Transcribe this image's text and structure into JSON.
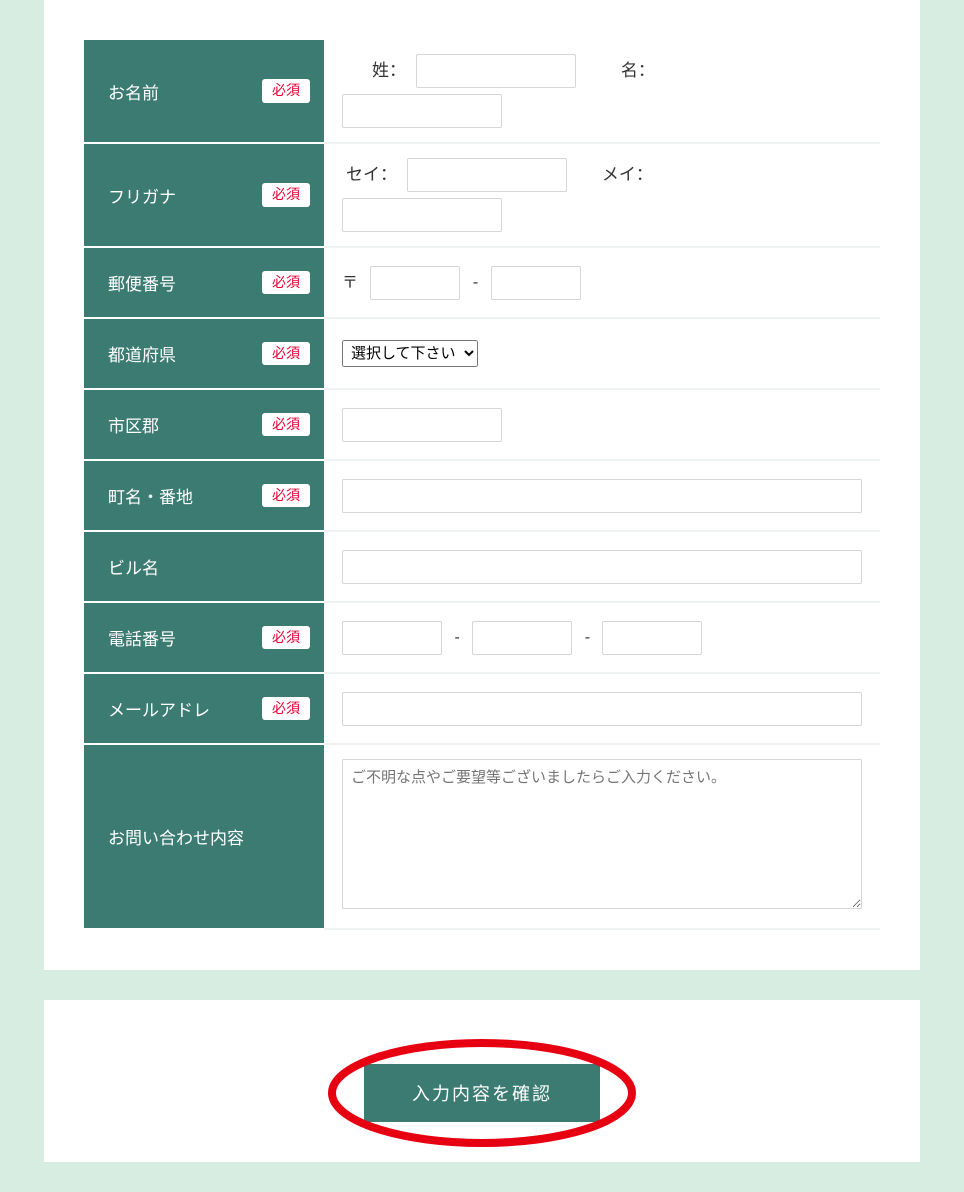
{
  "required_label": "必須",
  "rows": {
    "name": {
      "label": "お名前",
      "sei": "姓：",
      "mei": "名："
    },
    "kana": {
      "label": "フリガナ",
      "sei": "セイ：",
      "mei": "メイ："
    },
    "zip": {
      "label": "郵便番号",
      "mark": "〒",
      "sep": "-"
    },
    "pref": {
      "label": "都道府県",
      "placeholder": "選択して下さい"
    },
    "city": {
      "label": "市区郡"
    },
    "street": {
      "label": "町名・番地"
    },
    "building": {
      "label": "ビル名"
    },
    "tel": {
      "label": "電話番号",
      "sep": "-"
    },
    "email": {
      "label": "メールアドレ"
    },
    "inquiry": {
      "label": "お問い合わせ内容",
      "placeholder": "ご不明な点やご要望等ございましたらご入力ください。"
    }
  },
  "submit": "入力内容を確認"
}
